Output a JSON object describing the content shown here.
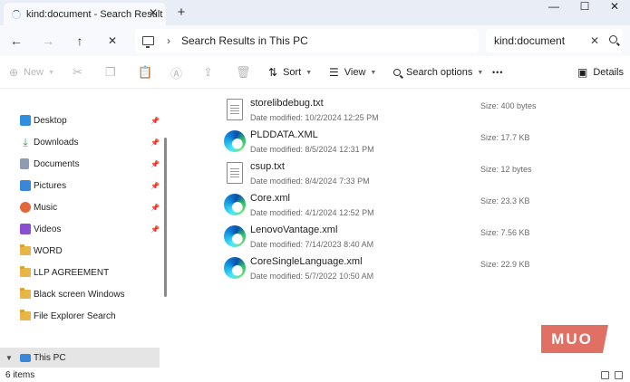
{
  "window": {
    "tab_title": "kind:document - Search Result",
    "tab_close": "✕",
    "new_tab": "+",
    "minimize": "—",
    "maximize": "☐",
    "close": "✕"
  },
  "address": {
    "back": "←",
    "forward": "→",
    "up": "↑",
    "stop": "✕",
    "separator": "›",
    "breadcrumb": "Search Results in This PC",
    "search_value": "kind:document",
    "search_clear": "✕"
  },
  "toolbar": {
    "new_label": "New",
    "sort_label": "Sort",
    "view_label": "View",
    "search_options_label": "Search options",
    "more": "•••",
    "details_label": "Details"
  },
  "sidebar": {
    "items": [
      {
        "label": "Desktop",
        "pinned": true,
        "icon": "desktop-icon"
      },
      {
        "label": "Downloads",
        "pinned": true,
        "icon": "downloads-icon"
      },
      {
        "label": "Documents",
        "pinned": true,
        "icon": "documents-icon"
      },
      {
        "label": "Pictures",
        "pinned": true,
        "icon": "pictures-icon"
      },
      {
        "label": "Music",
        "pinned": true,
        "icon": "music-icon"
      },
      {
        "label": "Videos",
        "pinned": true,
        "icon": "videos-icon"
      },
      {
        "label": "WORD",
        "pinned": false,
        "icon": "folder-icon"
      },
      {
        "label": "LLP AGREEMENT",
        "pinned": false,
        "icon": "folder-icon"
      },
      {
        "label": "Black screen Windows",
        "pinned": false,
        "icon": "folder-icon"
      },
      {
        "label": "File Explorer Search",
        "pinned": false,
        "icon": "folder-icon"
      }
    ],
    "this_pc": "This PC",
    "pin_glyph": "📌"
  },
  "files": [
    {
      "name": "storelibdebug.txt",
      "date": "Date modified: 10/2/2024 12:25 PM",
      "size": "Size: 400 bytes",
      "icon": "text-file-icon"
    },
    {
      "name": "PLDDATA.XML",
      "date": "Date modified: 8/5/2024 12:31 PM",
      "size": "Size: 17.7 KB",
      "icon": "edge-icon"
    },
    {
      "name": "csup.txt",
      "date": "Date modified: 8/4/2024 7:33 PM",
      "size": "Size: 12 bytes",
      "icon": "text-file-icon"
    },
    {
      "name": "Core.xml",
      "date": "Date modified: 4/1/2024 12:52 PM",
      "size": "Size: 23.3 KB",
      "icon": "edge-icon"
    },
    {
      "name": "LenovoVantage.xml",
      "date": "Date modified: 7/14/2023 8:40 AM",
      "size": "Size: 7.56 KB",
      "icon": "edge-icon"
    },
    {
      "name": "CoreSingleLanguage.xml",
      "date": "Date modified: 5/7/2022 10:50 AM",
      "size": "Size: 22.9 KB",
      "icon": "edge-icon"
    }
  ],
  "status": {
    "items_count": "6 items"
  },
  "watermark": "MUO",
  "colors": {
    "accent": "#1a5fb4",
    "folder": "#e8b548",
    "watermark": "#e06f64"
  }
}
